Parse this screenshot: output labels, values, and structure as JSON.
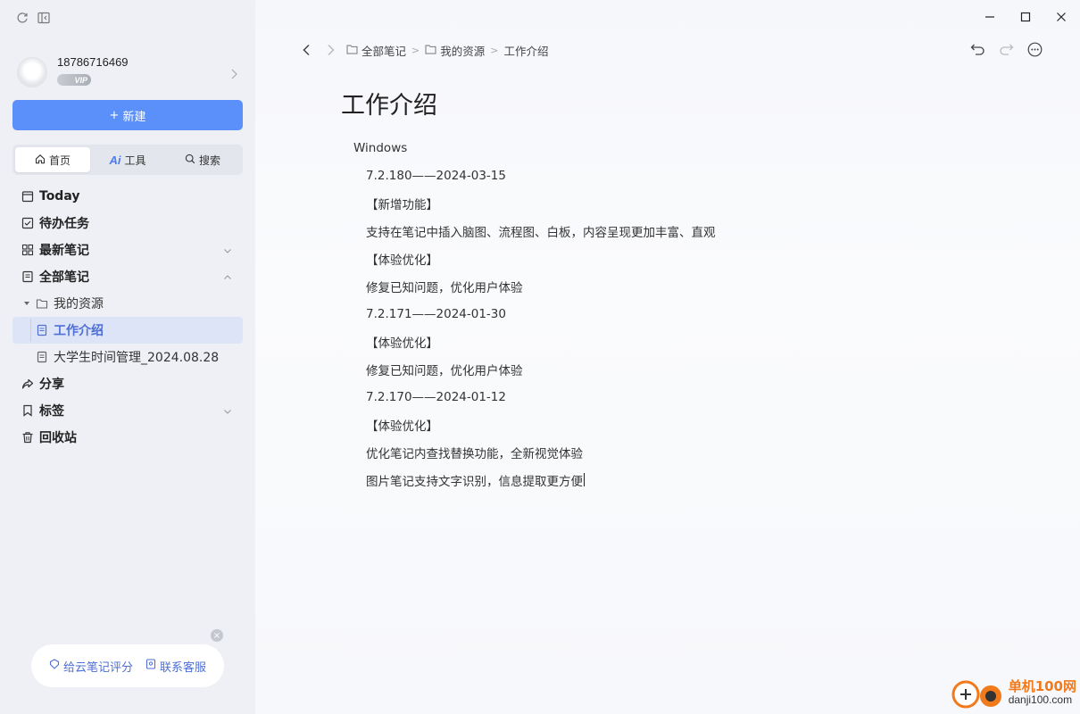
{
  "sidebar": {
    "user": {
      "phone": "18786716469",
      "vip": "VIP"
    },
    "new_button": {
      "plus": "+",
      "label": "新建"
    },
    "tabs": [
      {
        "label": "首页",
        "icon": "home-icon"
      },
      {
        "ai": "Ai",
        "label": "工具",
        "icon": "ai-icon"
      },
      {
        "label": "搜索",
        "icon": "search-icon"
      }
    ],
    "nav": {
      "today": "Today",
      "todo": "待办任务",
      "recent": "最新笔记",
      "all_notes": "全部笔记",
      "my_resources": "我的资源",
      "work_intro": "工作介绍",
      "time_mgmt": "大学生时间管理_2024.08.28",
      "share": "分享",
      "tags": "标签",
      "trash": "回收站"
    },
    "feedback": {
      "rate": "给云笔记评分",
      "support": "联系客服",
      "close": "×"
    }
  },
  "main": {
    "breadcrumb": [
      "全部笔记",
      "我的资源",
      "工作介绍"
    ],
    "separator": ">",
    "title": "工作介绍",
    "lines": [
      "Windows",
      "7.2.180——2024-03-15",
      "【新增功能】",
      "支持在笔记中插入脑图、流程图、白板，内容呈现更加丰富、直观",
      "【体验优化】",
      "修复已知问题，优化用户体验",
      "7.2.171——2024-01-30",
      "【体验优化】",
      "修复已知问题，优化用户体验",
      "7.2.170——2024-01-12",
      "【体验优化】",
      "优化笔记内查找替换功能，全新视觉体验",
      "图片笔记支持文字识别，信息提取更方便"
    ]
  },
  "watermark": {
    "site": "单机100网",
    "url": "danji100.com"
  },
  "colors": {
    "accent": "#5b8ff9",
    "selected_bg": "#dde4f7",
    "watermark": "#f07a1c"
  }
}
